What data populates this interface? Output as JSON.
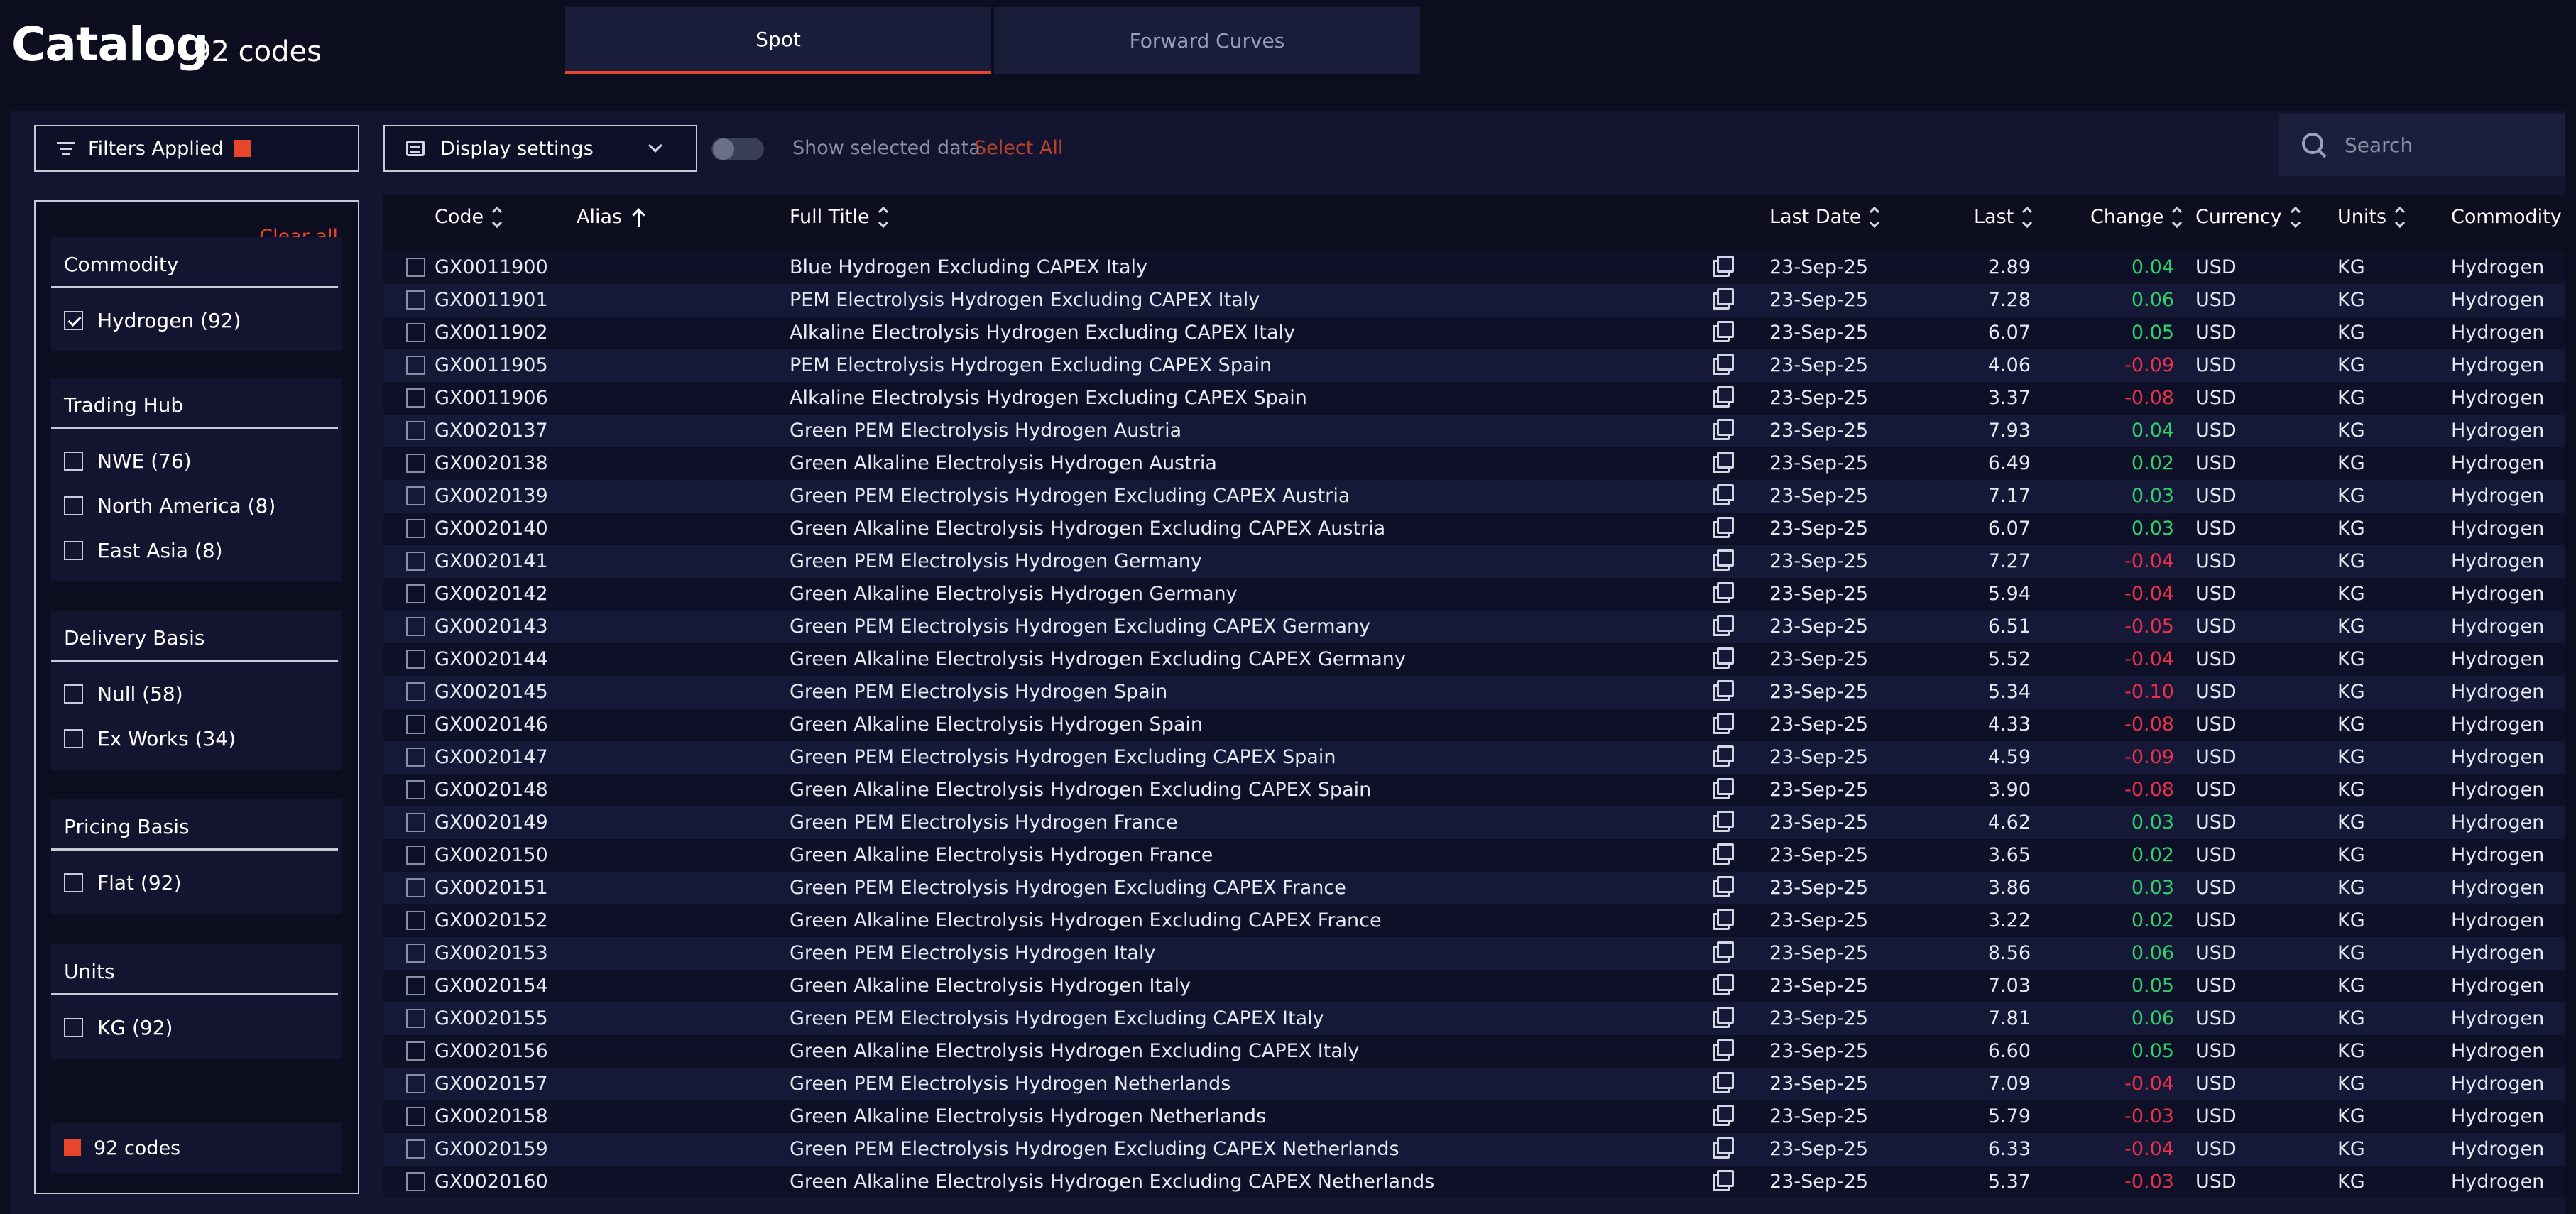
{
  "header": {
    "title": "Catalog",
    "count": "92 codes",
    "tabs": [
      {
        "label": "Spot",
        "active": true
      },
      {
        "label": "Forward Curves",
        "active": false
      }
    ]
  },
  "toolbar": {
    "filters_label": "Filters Applied",
    "display_label": "Display settings",
    "show_selected_label": "Show selected data",
    "select_all_label": "Select All",
    "search_placeholder": "Search"
  },
  "colors": {
    "accent": "#e8462a",
    "positive": "#2fcf6a",
    "negative": "#e8324a",
    "background": "#0c0d1e"
  },
  "sidebar": {
    "clear_all": "Clear all",
    "groups": [
      {
        "title": "Commodity",
        "options": [
          {
            "label": "Hydrogen (92)",
            "checked": true
          }
        ]
      },
      {
        "title": "Trading Hub",
        "options": [
          {
            "label": "NWE (76)",
            "checked": false
          },
          {
            "label": "North America (8)",
            "checked": false
          },
          {
            "label": "East Asia (8)",
            "checked": false
          }
        ]
      },
      {
        "title": "Delivery Basis",
        "options": [
          {
            "label": "Null (58)",
            "checked": false
          },
          {
            "label": "Ex Works (34)",
            "checked": false
          }
        ]
      },
      {
        "title": "Pricing Basis",
        "options": [
          {
            "label": "Flat (92)",
            "checked": false
          }
        ]
      },
      {
        "title": "Units",
        "options": [
          {
            "label": "KG (92)",
            "checked": false
          }
        ]
      }
    ],
    "footer": "92 codes"
  },
  "table": {
    "columns": {
      "code": "Code",
      "alias": "Alias",
      "title": "Full Title",
      "last_date": "Last Date",
      "last": "Last",
      "change": "Change",
      "currency": "Currency",
      "units": "Units",
      "commodity": "Commodity"
    },
    "rows": [
      {
        "code": "GX0011900",
        "title": "Blue Hydrogen Excluding CAPEX Italy",
        "date": "23-Sep-25",
        "last": "2.89",
        "change": "0.04",
        "currency": "USD",
        "units": "KG",
        "commodity": "Hydrogen"
      },
      {
        "code": "GX0011901",
        "title": "PEM Electrolysis Hydrogen Excluding CAPEX Italy",
        "date": "23-Sep-25",
        "last": "7.28",
        "change": "0.06",
        "currency": "USD",
        "units": "KG",
        "commodity": "Hydrogen"
      },
      {
        "code": "GX0011902",
        "title": "Alkaline Electrolysis Hydrogen Excluding CAPEX Italy",
        "date": "23-Sep-25",
        "last": "6.07",
        "change": "0.05",
        "currency": "USD",
        "units": "KG",
        "commodity": "Hydrogen"
      },
      {
        "code": "GX0011905",
        "title": "PEM Electrolysis Hydrogen Excluding CAPEX Spain",
        "date": "23-Sep-25",
        "last": "4.06",
        "change": "-0.09",
        "currency": "USD",
        "units": "KG",
        "commodity": "Hydrogen"
      },
      {
        "code": "GX0011906",
        "title": "Alkaline Electrolysis Hydrogen Excluding CAPEX Spain",
        "date": "23-Sep-25",
        "last": "3.37",
        "change": "-0.08",
        "currency": "USD",
        "units": "KG",
        "commodity": "Hydrogen"
      },
      {
        "code": "GX0020137",
        "title": "Green PEM Electrolysis Hydrogen Austria",
        "date": "23-Sep-25",
        "last": "7.93",
        "change": "0.04",
        "currency": "USD",
        "units": "KG",
        "commodity": "Hydrogen"
      },
      {
        "code": "GX0020138",
        "title": "Green Alkaline Electrolysis Hydrogen Austria",
        "date": "23-Sep-25",
        "last": "6.49",
        "change": "0.02",
        "currency": "USD",
        "units": "KG",
        "commodity": "Hydrogen"
      },
      {
        "code": "GX0020139",
        "title": "Green PEM Electrolysis Hydrogen Excluding CAPEX Austria",
        "date": "23-Sep-25",
        "last": "7.17",
        "change": "0.03",
        "currency": "USD",
        "units": "KG",
        "commodity": "Hydrogen"
      },
      {
        "code": "GX0020140",
        "title": "Green Alkaline Electrolysis Hydrogen Excluding CAPEX Austria",
        "date": "23-Sep-25",
        "last": "6.07",
        "change": "0.03",
        "currency": "USD",
        "units": "KG",
        "commodity": "Hydrogen"
      },
      {
        "code": "GX0020141",
        "title": "Green PEM Electrolysis Hydrogen Germany",
        "date": "23-Sep-25",
        "last": "7.27",
        "change": "-0.04",
        "currency": "USD",
        "units": "KG",
        "commodity": "Hydrogen"
      },
      {
        "code": "GX0020142",
        "title": "Green Alkaline Electrolysis Hydrogen Germany",
        "date": "23-Sep-25",
        "last": "5.94",
        "change": "-0.04",
        "currency": "USD",
        "units": "KG",
        "commodity": "Hydrogen"
      },
      {
        "code": "GX0020143",
        "title": "Green PEM Electrolysis Hydrogen Excluding CAPEX Germany",
        "date": "23-Sep-25",
        "last": "6.51",
        "change": "-0.05",
        "currency": "USD",
        "units": "KG",
        "commodity": "Hydrogen"
      },
      {
        "code": "GX0020144",
        "title": "Green Alkaline Electrolysis Hydrogen Excluding CAPEX Germany",
        "date": "23-Sep-25",
        "last": "5.52",
        "change": "-0.04",
        "currency": "USD",
        "units": "KG",
        "commodity": "Hydrogen"
      },
      {
        "code": "GX0020145",
        "title": "Green PEM Electrolysis Hydrogen Spain",
        "date": "23-Sep-25",
        "last": "5.34",
        "change": "-0.10",
        "currency": "USD",
        "units": "KG",
        "commodity": "Hydrogen"
      },
      {
        "code": "GX0020146",
        "title": "Green Alkaline Electrolysis Hydrogen Spain",
        "date": "23-Sep-25",
        "last": "4.33",
        "change": "-0.08",
        "currency": "USD",
        "units": "KG",
        "commodity": "Hydrogen"
      },
      {
        "code": "GX0020147",
        "title": "Green PEM Electrolysis Hydrogen Excluding CAPEX Spain",
        "date": "23-Sep-25",
        "last": "4.59",
        "change": "-0.09",
        "currency": "USD",
        "units": "KG",
        "commodity": "Hydrogen"
      },
      {
        "code": "GX0020148",
        "title": "Green Alkaline Electrolysis Hydrogen Excluding CAPEX Spain",
        "date": "23-Sep-25",
        "last": "3.90",
        "change": "-0.08",
        "currency": "USD",
        "units": "KG",
        "commodity": "Hydrogen"
      },
      {
        "code": "GX0020149",
        "title": "Green PEM Electrolysis Hydrogen France",
        "date": "23-Sep-25",
        "last": "4.62",
        "change": "0.03",
        "currency": "USD",
        "units": "KG",
        "commodity": "Hydrogen"
      },
      {
        "code": "GX0020150",
        "title": "Green Alkaline Electrolysis Hydrogen France",
        "date": "23-Sep-25",
        "last": "3.65",
        "change": "0.02",
        "currency": "USD",
        "units": "KG",
        "commodity": "Hydrogen"
      },
      {
        "code": "GX0020151",
        "title": "Green PEM Electrolysis Hydrogen Excluding CAPEX France",
        "date": "23-Sep-25",
        "last": "3.86",
        "change": "0.03",
        "currency": "USD",
        "units": "KG",
        "commodity": "Hydrogen"
      },
      {
        "code": "GX0020152",
        "title": "Green Alkaline Electrolysis Hydrogen Excluding CAPEX France",
        "date": "23-Sep-25",
        "last": "3.22",
        "change": "0.02",
        "currency": "USD",
        "units": "KG",
        "commodity": "Hydrogen"
      },
      {
        "code": "GX0020153",
        "title": "Green PEM Electrolysis Hydrogen Italy",
        "date": "23-Sep-25",
        "last": "8.56",
        "change": "0.06",
        "currency": "USD",
        "units": "KG",
        "commodity": "Hydrogen"
      },
      {
        "code": "GX0020154",
        "title": "Green Alkaline Electrolysis Hydrogen Italy",
        "date": "23-Sep-25",
        "last": "7.03",
        "change": "0.05",
        "currency": "USD",
        "units": "KG",
        "commodity": "Hydrogen"
      },
      {
        "code": "GX0020155",
        "title": "Green PEM Electrolysis Hydrogen Excluding CAPEX Italy",
        "date": "23-Sep-25",
        "last": "7.81",
        "change": "0.06",
        "currency": "USD",
        "units": "KG",
        "commodity": "Hydrogen"
      },
      {
        "code": "GX0020156",
        "title": "Green Alkaline Electrolysis Hydrogen Excluding CAPEX Italy",
        "date": "23-Sep-25",
        "last": "6.60",
        "change": "0.05",
        "currency": "USD",
        "units": "KG",
        "commodity": "Hydrogen"
      },
      {
        "code": "GX0020157",
        "title": "Green PEM Electrolysis Hydrogen Netherlands",
        "date": "23-Sep-25",
        "last": "7.09",
        "change": "-0.04",
        "currency": "USD",
        "units": "KG",
        "commodity": "Hydrogen"
      },
      {
        "code": "GX0020158",
        "title": "Green Alkaline Electrolysis Hydrogen Netherlands",
        "date": "23-Sep-25",
        "last": "5.79",
        "change": "-0.03",
        "currency": "USD",
        "units": "KG",
        "commodity": "Hydrogen"
      },
      {
        "code": "GX0020159",
        "title": "Green PEM Electrolysis Hydrogen Excluding CAPEX Netherlands",
        "date": "23-Sep-25",
        "last": "6.33",
        "change": "-0.04",
        "currency": "USD",
        "units": "KG",
        "commodity": "Hydrogen"
      },
      {
        "code": "GX0020160",
        "title": "Green Alkaline Electrolysis Hydrogen Excluding CAPEX Netherlands",
        "date": "23-Sep-25",
        "last": "5.37",
        "change": "-0.03",
        "currency": "USD",
        "units": "KG",
        "commodity": "Hydrogen"
      }
    ]
  }
}
